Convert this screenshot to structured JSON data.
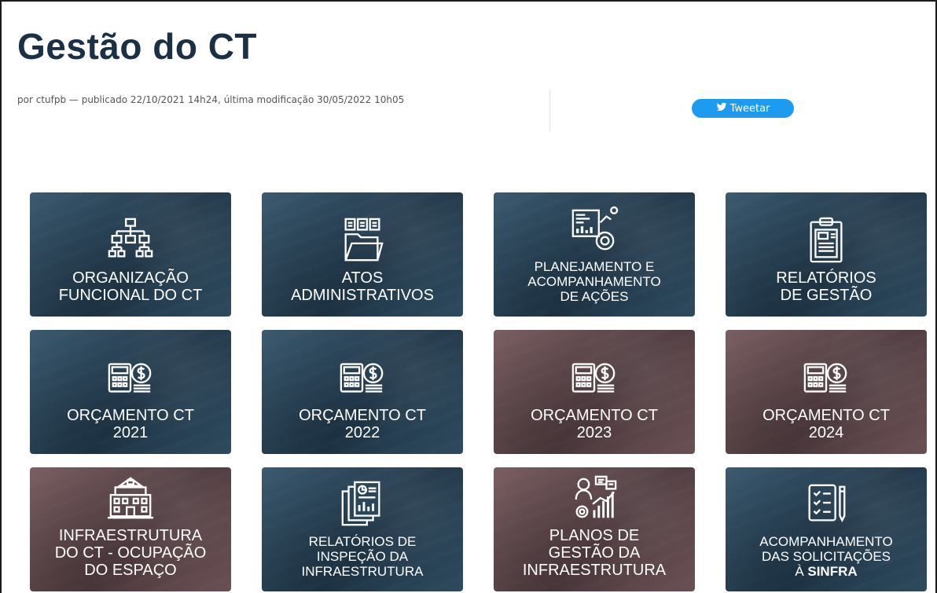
{
  "page": {
    "title": "Gestão do CT",
    "byline": "por ctufpb — publicado 22/10/2021 14h24, última modificação 30/05/2022 10h05",
    "tweet_label": "Tweetar"
  },
  "colors": {
    "title": "#1b2f45",
    "tweet": "#1d9bf0",
    "tile_blue": "#1f3648",
    "tile_mauve": "#4e3a3e"
  },
  "tiles": [
    {
      "label": "ORGANIZAÇÃO\nFUNCIONAL DO CT",
      "icon": "org-chart-icon"
    },
    {
      "label": "ATOS\nADMINISTRATIVOS",
      "icon": "documents-folder-icon"
    },
    {
      "label": "PLANEJAMENTO E\nACOMPANHAMENTO\nDE AÇÕES",
      "icon": "analytics-board-icon"
    },
    {
      "label": "RELATÓRIOS\nDE GESTÃO",
      "icon": "clipboard-report-icon"
    },
    {
      "label": "ORÇAMENTO CT\n2021",
      "icon": "calculator-money-icon"
    },
    {
      "label": "ORÇAMENTO CT\n2022",
      "icon": "calculator-money-icon"
    },
    {
      "label": "ORÇAMENTO CT\n2023",
      "icon": "calculator-money-icon"
    },
    {
      "label": "ORÇAMENTO CT\n2024",
      "icon": "calculator-money-icon"
    },
    {
      "label": "INFRAESTRUTURA\nDO CT - OCUPAÇÃO\nDO ESPAÇO",
      "icon": "building-icon"
    },
    {
      "label": "RELATÓRIOS DE\nINSPEÇÃO DA\nINFRAESTRUTURA",
      "icon": "report-pages-icon"
    },
    {
      "label": "PLANOS DE\nGESTÃO DA\nINFRAESTRUTURA",
      "icon": "manager-chart-icon"
    },
    {
      "label_main": "ACOMPANHAMENTO\nDAS SOLICITAÇÕES\nÀ ",
      "label_bold": "SINFRA",
      "icon": "checklist-pen-icon"
    }
  ]
}
